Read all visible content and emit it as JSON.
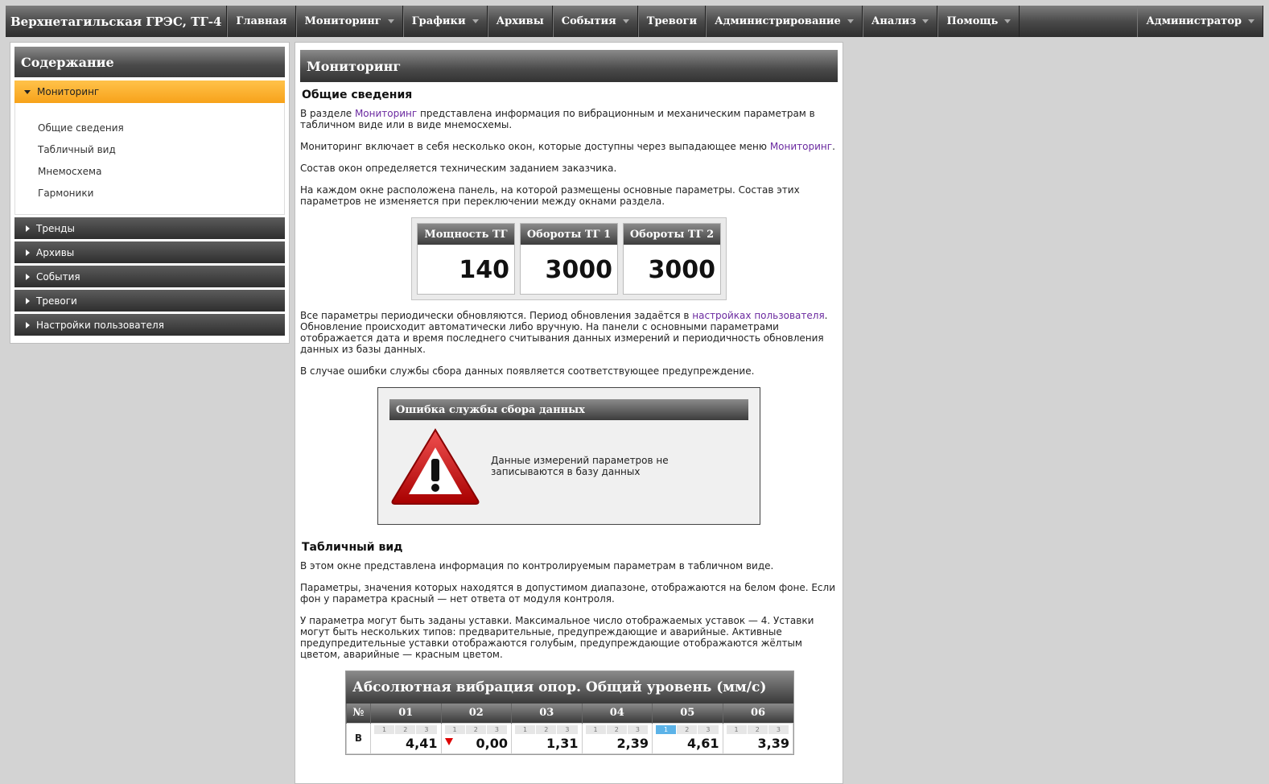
{
  "topbar": {
    "brand": "Верхнетагильская ГРЭС, ТГ-4",
    "items": [
      {
        "label": "Главная",
        "caret": false
      },
      {
        "label": "Мониторинг",
        "caret": true
      },
      {
        "label": "Графики",
        "caret": true
      },
      {
        "label": "Архивы",
        "caret": false
      },
      {
        "label": "События",
        "caret": true
      },
      {
        "label": "Тревоги",
        "caret": false
      },
      {
        "label": "Администрирование",
        "caret": true
      },
      {
        "label": "Анализ",
        "caret": true
      },
      {
        "label": "Помощь",
        "caret": true
      }
    ],
    "user": "Администратор"
  },
  "sidebar": {
    "title": "Содержание",
    "active": "Мониторинг",
    "subitems": [
      "Общие сведения",
      "Табличный вид",
      "Мнемосхема",
      "Гармоники"
    ],
    "sections": [
      "Тренды",
      "Архивы",
      "События",
      "Тревоги",
      "Настройки пользователя"
    ]
  },
  "content": {
    "title": "Мониторинг",
    "h_general": "Общие сведения",
    "p1_pre": "В разделе ",
    "p1_link": "Мониторинг",
    "p1_post": " представлена информация по вибрационным и механическим параметрам в табличном виде или в виде мнемосхемы.",
    "p2_pre": "Мониторинг включает в себя несколько окон, которые доступны через выпадающее меню ",
    "p2_link": "Мониторинг",
    "p2_post": ".",
    "p3": "Состав окон определяется техническим заданием заказчика.",
    "p4": "На каждом окне расположена панель, на которой размещены основные параметры. Состав этих параметров не изменяется при переключении между окнами раздела.",
    "params": [
      {
        "title": "Мощность ТГ",
        "value": "140"
      },
      {
        "title": "Обороты ТГ 1",
        "value": "3000"
      },
      {
        "title": "Обороты ТГ 2",
        "value": "3000"
      }
    ],
    "p5_pre": "Все параметры периодически обновляются. Период обновления задаётся в ",
    "p5_link": "настройках пользователя",
    "p5_post": ". Обновление происходит автоматически либо вручную. На панели с основными параметрами отображается дата и время последнего считывания данных измерений и периодичность обновления данных из базы данных.",
    "p6": "В случае ошибки службы сбора данных появляется соответствующее предупреждение.",
    "error_title": "Ошибка службы сбора данных",
    "error_msg": "Данные измерений параметров не записываются в базу данных",
    "h_table": "Табличный вид",
    "p7": "В этом окне представлена информация по контролируемым параметрам в табличном виде.",
    "p8": "Параметры, значения которых находятся в допустимом диапазоне, отображаются на белом фоне. Если фон у параметра красный — нет ответа от модуля контроля.",
    "p9": "У параметра могут быть заданы уставки. Максимальное число отображаемых уставок — 4. Уставки могут быть нескольких типов: предварительные, предупреждающие и аварийные. Активные предупредительные уставки отображаются голубым, предупреждающие отображаются жёлтым цветом, аварийные — красным цветом."
  },
  "vib_table": {
    "title": "Абсолютная вибрация опор. Общий уровень (мм/с)",
    "corner": "№",
    "columns": [
      "01",
      "02",
      "03",
      "04",
      "05",
      "06"
    ],
    "setpoint_labels": [
      "1",
      "2",
      "3"
    ],
    "row_label": "В",
    "values": [
      "4,41",
      "0,00",
      "1,31",
      "2,39",
      "4,61",
      "3,39"
    ]
  },
  "colors": {
    "accent": "#f7a21a",
    "link": "#6b2aa0",
    "setpoint_active": "#5cb3e8",
    "alarm": "#dd0000"
  }
}
